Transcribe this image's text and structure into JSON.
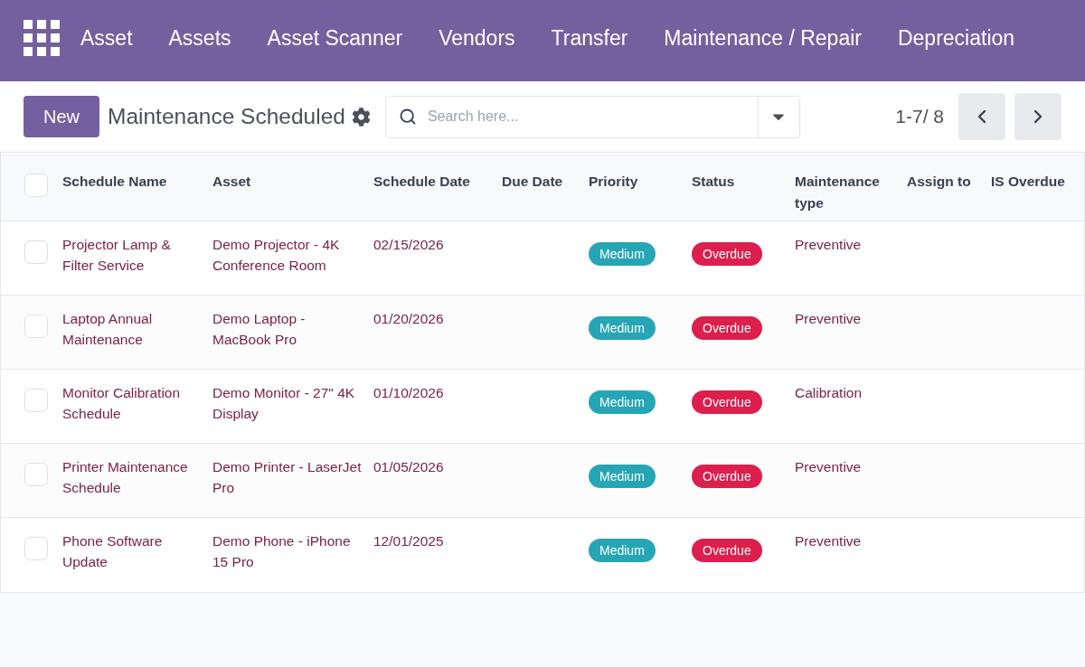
{
  "navbar": {
    "app_name": "Asset",
    "menu": [
      "Assets",
      "Asset Scanner",
      "Vendors",
      "Transfer",
      "Maintenance / Repair",
      "Depreciation"
    ]
  },
  "control_panel": {
    "new_button": "New",
    "title": "Maintenance Scheduled",
    "search": {
      "placeholder": "Search here..."
    },
    "pager": "1-7/ 8"
  },
  "table": {
    "select_all": {
      "checked": false
    },
    "columns": [
      "Schedule Name",
      "Asset",
      "Schedule Date",
      "Due Date",
      "Priority",
      "Status",
      "Maintenance type",
      "Assign to",
      "IS Overdue"
    ],
    "rows": [
      {
        "checked": false,
        "schedule_name": "Projector Lamp & Filter Service",
        "asset": "Demo Projector - 4K Conference Room",
        "schedule_date": "02/15/2026",
        "priority": {
          "label": "Medium",
          "color": "#26a5b5"
        },
        "status": {
          "label": "Overdue",
          "color": "#dc1f4d"
        },
        "maintenance_type": "Preventive"
      },
      {
        "checked": false,
        "schedule_name": "Laptop Annual Maintenance",
        "asset": "Demo Laptop - MacBook Pro",
        "schedule_date": "01/20/2026",
        "priority": {
          "label": "Medium",
          "color": "#26a5b5"
        },
        "status": {
          "label": "Overdue",
          "color": "#dc1f4d"
        },
        "maintenance_type": "Preventive"
      },
      {
        "checked": false,
        "schedule_name": "Monitor Calibration Schedule",
        "asset": "Demo Monitor - 27\" 4K Display",
        "schedule_date": "01/10/2026",
        "priority": {
          "label": "Medium",
          "color": "#26a5b5"
        },
        "status": {
          "label": "Overdue",
          "color": "#dc1f4d"
        },
        "maintenance_type": "Calibration"
      },
      {
        "checked": false,
        "schedule_name": "Printer Maintenance Schedule",
        "asset": "Demo Printer - LaserJet Pro",
        "schedule_date": "01/05/2026",
        "priority": {
          "label": "Medium",
          "color": "#26a5b5"
        },
        "status": {
          "label": "Overdue",
          "color": "#dc1f4d"
        },
        "maintenance_type": "Preventive"
      },
      {
        "checked": false,
        "schedule_name": "Phone Software Update",
        "asset": "Demo Phone - iPhone 15 Pro",
        "schedule_date": "12/01/2025",
        "priority": {
          "label": "Medium",
          "color": "#26a5b5"
        },
        "status": {
          "label": "Overdue",
          "color": "#dc1f4d"
        },
        "maintenance_type": "Preventive"
      }
    ]
  }
}
